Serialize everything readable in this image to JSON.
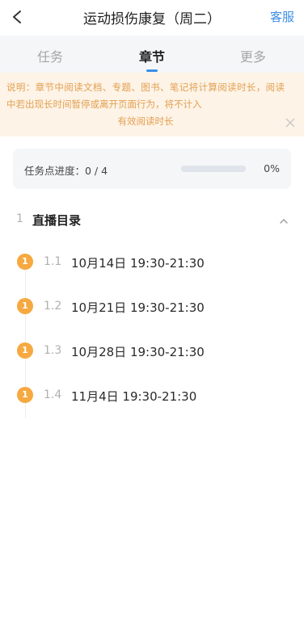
{
  "header": {
    "title": "运动损伤康复（周二）",
    "service_label": "客服"
  },
  "tabs": [
    {
      "label": "任务",
      "active": false
    },
    {
      "label": "章节",
      "active": true
    },
    {
      "label": "更多",
      "active": false
    }
  ],
  "notice": {
    "line1": "说明：章节中阅读文档、专题、图书、笔记将计算阅读时长，阅读中若出现长时间暂停或离开页面行为，将不计入",
    "line2": "有效阅读时长"
  },
  "progress": {
    "label": "任务点进度：0 / 4",
    "percent_label": "0%",
    "fraction": 0
  },
  "section": {
    "number": "1",
    "title": "直播目录",
    "expanded": true
  },
  "items": [
    {
      "badge": "1",
      "number": "1.1",
      "title": "10月14日 19:30-21:30"
    },
    {
      "badge": "1",
      "number": "1.2",
      "title": "10月21日 19:30-21:30"
    },
    {
      "badge": "1",
      "number": "1.3",
      "title": "10月28日 19:30-21:30"
    },
    {
      "badge": "1",
      "number": "1.4",
      "title": "11月4日 19:30-21:30"
    }
  ],
  "colors": {
    "accent": "#3a8ee6",
    "badge": "#f6a940",
    "notice_bg": "#fdf3e6",
    "notice_text": "#e3a052"
  }
}
